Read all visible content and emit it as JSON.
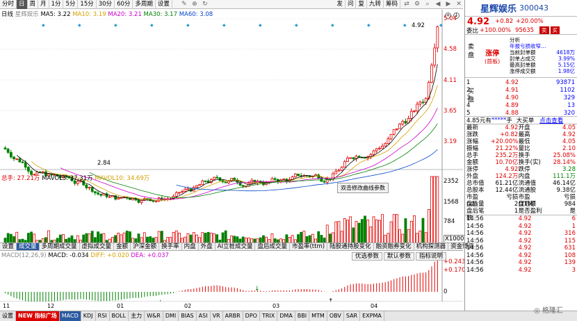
{
  "toolbar": {
    "items": [
      "分时",
      "日",
      "周",
      "月",
      "1分",
      "5分",
      "15分",
      "30分",
      "60分",
      "多周期",
      "设置"
    ],
    "selected": "日",
    "right": [
      "发",
      "问",
      "复",
      "九转",
      "筹码",
      "相",
      "图"
    ]
  },
  "chart": {
    "legend": {
      "name": "日线",
      "series": "星辉娱乐",
      "ma5": "MA5: 3.22",
      "ma10": "MA10: 3.19",
      "ma20": "MA20: 3.21",
      "ma30": "MA30: 3.17",
      "ma60": "MA60: 3.08"
    },
    "price_ticks": [
      "5.04",
      "4.58",
      "4.11",
      "3.65",
      "3.19"
    ],
    "high_label": "4.92",
    "low_label": "2.84",
    "vol_legend": {
      "total": "总手: 27.21万",
      "mavol5": "MAVOL5: 37.31万",
      "mavol10": "MAVOL10: 34.69万"
    },
    "vol_ticks": [
      "2352",
      "1568",
      "784",
      "X1000"
    ],
    "tooltip": "双击修改曲线参数"
  },
  "tabs": [
    "设置",
    "成交量",
    "多周期成交量",
    "虚拟成交量",
    "金额",
    "沪深金额",
    "换手率",
    "内盘",
    "外盘",
    "AI立桩成交量",
    "盘后成交量",
    "市盈率(ttm)",
    "陆股通持股变化",
    "融资融券变化",
    "机构探测器",
    "资金博弈"
  ],
  "tabs_selected": "成交量",
  "macd": {
    "legend": {
      "name": "MACD(12,26,9)",
      "macd": "MACD: -0.034",
      "diff": "DIFF: +0.020",
      "dea": "DEA: +0.037"
    },
    "buttons": [
      "优选参数",
      "默认参数",
      "指标说明"
    ],
    "ticks": [
      "+0.243",
      "+0.170",
      "0"
    ]
  },
  "dates": [
    "11",
    "12",
    "01",
    "02",
    "03",
    "04"
  ],
  "bottom_tabs": [
    "设置",
    "NEW 指标广场",
    "MACD",
    "KDJ",
    "RSI",
    "BOLL",
    "主力",
    "W&R",
    "DMI",
    "BIAS",
    "ASI",
    "VR",
    "ARBR",
    "DPO",
    "TRIX",
    "DMA",
    "BBI",
    "MTM",
    "OBV",
    "SAR",
    "EXPMA"
  ],
  "bottom_selected": "MACD",
  "panel": {
    "name": "星辉娱乐",
    "code": "300043",
    "price": "4.92",
    "change": "+0.82",
    "pct": "+20.00%",
    "weibi_label": "委比",
    "weibi": "+100.00%",
    "weicha": "95635",
    "analysis": [
      "分析",
      "年报亏损收窄…",
      "当前封单额",
      "封单占成交",
      "最高封单额",
      "涨停成交额"
    ],
    "analysis_vals": [
      "",
      "",
      "4618万",
      "3.99%",
      "5.15亿",
      "1.98亿"
    ],
    "limit": "涨停",
    "limit_sub": "(首板)",
    "sell_label": [
      "卖",
      "盘"
    ],
    "buy_label": [
      "买",
      "盘"
    ],
    "bids": [
      [
        "1",
        "4.92",
        "93871"
      ],
      [
        "2",
        "4.91",
        "1102"
      ],
      [
        "3",
        "4.90",
        "329"
      ],
      [
        "4",
        "4.89",
        "13"
      ],
      [
        "5",
        "4.88",
        "320"
      ]
    ],
    "mid": {
      "left": "4.85元有",
      "stars": "*****",
      "hand": "手",
      "right": "大买单",
      "link": "点击查看"
    },
    "stats": [
      [
        "最新",
        "4.92",
        "开盘",
        "4.05"
      ],
      [
        "涨跌",
        "+0.82",
        "最高",
        "4.92"
      ],
      [
        "涨幅",
        "+20.00%",
        "最低",
        "4.05"
      ],
      [
        "振幅",
        "21.22%",
        "量比",
        "2.10"
      ],
      [
        "总手",
        "235.2万",
        "换手",
        "25.08%"
      ],
      [
        "金额",
        "10.70亿",
        "换手(实)",
        "28.14%"
      ],
      [
        "涨停",
        "4.92",
        "跌停",
        "3.28"
      ],
      [
        "外盘",
        "124.2万",
        "内盘",
        "111.1万"
      ],
      [
        "总市值",
        "61.21亿",
        "流通值",
        "46.14亿"
      ],
      [
        "总股本",
        "12.44亿",
        "流通股",
        "9.38亿"
      ],
      [
        "市盈(动)",
        "亏损",
        "市盈(TTM)",
        "亏损"
      ],
      [
        "盘后量",
        "2",
        "盘后额",
        "984"
      ],
      [
        "盘后笔数",
        "1",
        "是否盈利",
        "是"
      ]
    ],
    "ticks": [
      [
        "14:56",
        "4.92",
        "6"
      ],
      [
        "14:56",
        "4.92",
        "1"
      ],
      [
        "14:56",
        "4.92",
        "316"
      ],
      [
        "14:56",
        "4.92",
        "115"
      ],
      [
        "14:56",
        "4.92",
        "631"
      ],
      [
        "14:56",
        "4.92",
        "108"
      ],
      [
        "14:56",
        "4.92",
        "139"
      ],
      [
        "14:56",
        "4.92",
        "3"
      ]
    ]
  },
  "colors": {
    "up": "#e00000",
    "down": "#008000",
    "ma5": "#000000",
    "ma10": "#d4a000",
    "ma20": "#cc00cc",
    "ma30": "#008000",
    "ma60": "#0044cc"
  }
}
